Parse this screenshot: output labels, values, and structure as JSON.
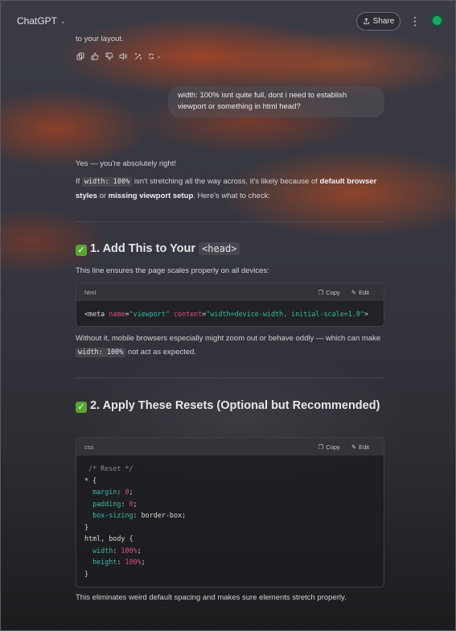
{
  "header": {
    "model_label": "ChatGPT",
    "share_label": "Share"
  },
  "previous": {
    "tail_text": "to your layout."
  },
  "user_message": "width: 100% isnt quite full, dont i need to establish viewport or something in html head?",
  "reply": {
    "intro": "Yes — you're absolutely right!",
    "p1_a": "If ",
    "p1_code": "width: 100%",
    "p1_b": " isn't stretching all the way across, it's likely because of ",
    "p1_bold1": "default browser styles",
    "p1_c": " or ",
    "p1_bold2": "missing viewport setup",
    "p1_d": ". Here's what to check:",
    "section1": {
      "title_prefix": "1. Add This to Your ",
      "title_code": "<head>",
      "lead": "This line ensures the page scales properly on all devices:",
      "code_lang": "html",
      "copy_label": "Copy",
      "edit_label": "Edit",
      "code": {
        "open": "<meta ",
        "attr1": "name",
        "eq1": "=",
        "val1": "\"viewport\"",
        "sp": " ",
        "attr2": "content",
        "eq2": "=",
        "val2": "\"width=device-width, initial-scale=1.0\"",
        "close": ">"
      },
      "after_a": "Without it, mobile browsers especially might zoom out or behave oddly — which can make ",
      "after_code": "width: 100%",
      "after_b": " not act as expected."
    },
    "section2": {
      "title": "2. Apply These Resets (Optional but Recommended)",
      "code_lang": "css",
      "copy_label": "Copy",
      "edit_label": "Edit",
      "lines": {
        "comment": "/* Reset */",
        "sel1": "* {",
        "margin_prop": "margin",
        "margin_val": "0",
        "padding_prop": "padding",
        "padding_val": "0",
        "boxsizing_prop": "box-sizing",
        "boxsizing_val": "border-box",
        "close1": "}",
        "sel2": "html, body {",
        "width_prop": "width",
        "width_val": "100%",
        "height_prop": "height",
        "height_val": "100%",
        "close2": "}"
      },
      "after": "This eliminates weird default spacing and makes sure elements stretch properly."
    }
  },
  "colors": {
    "accent_check": "#5aa532",
    "code_string": "#36b99e",
    "code_number": "#d9507e"
  }
}
